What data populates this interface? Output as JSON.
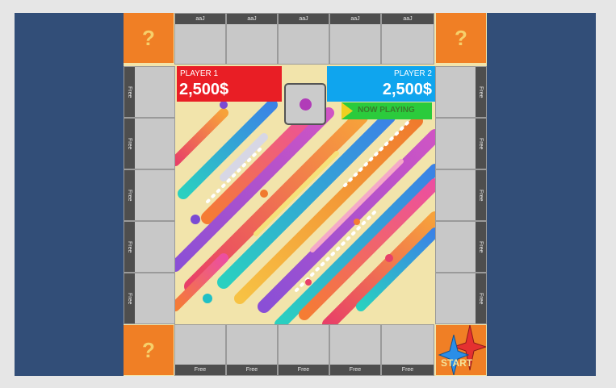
{
  "players": [
    {
      "name": "PLAYER 1",
      "money": "2,500$",
      "color": "#e91e25"
    },
    {
      "name": "PLAYER 2",
      "money": "2,500$",
      "color": "#0fa5ee"
    }
  ],
  "now_playing": "NOW PLAYING",
  "dice": {
    "pip_color": "#b13cb8"
  },
  "corners": {
    "mystery_label": "?",
    "start_label": "START"
  },
  "top_row": [
    "aaJ",
    "aaJ",
    "aaJ",
    "aaJ",
    "aaJ"
  ],
  "bottom_row": [
    "Free",
    "Free",
    "Free",
    "Free",
    "Free"
  ],
  "left_col": [
    "Free",
    "Free",
    "Free",
    "Free",
    "Free"
  ],
  "right_col": [
    "Free",
    "Free",
    "Free",
    "Free",
    "Free"
  ],
  "colors": {
    "board_bg": "#f2e4ab",
    "corner": "#f07f25",
    "stage": "#324e78",
    "now_playing_bg": "#2bcb3c"
  }
}
